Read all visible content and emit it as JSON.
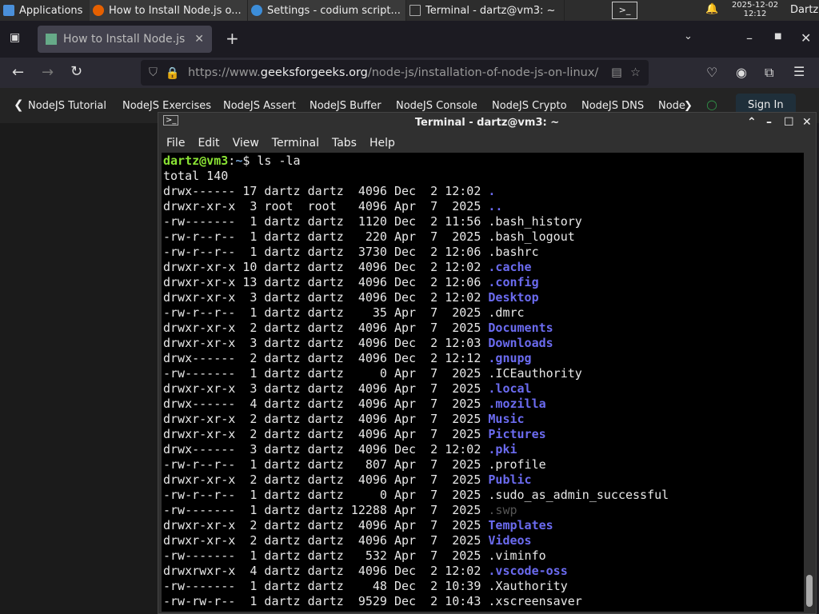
{
  "taskbar": {
    "applications": "Applications",
    "windows": [
      "How to Install Node.js o...",
      "Settings - codium script...",
      "Terminal - dartz@vm3: ~"
    ],
    "date": "2025-12-02",
    "time": "12:12",
    "user": "Dartz"
  },
  "browser": {
    "tab_title": "How to Install Node.js or",
    "url_prefix": "https://www.",
    "url_domain": "geeksforgeeks.org",
    "url_path": "/node-js/installation-of-node-js-on-linux/",
    "nav_items": [
      "NodeJS Tutorial",
      "NodeJS Exercises",
      "NodeJS Assert",
      "NodeJS Buffer",
      "NodeJS Console",
      "NodeJS Crypto",
      "NodeJS DNS",
      "Node"
    ],
    "sign_in": "Sign In"
  },
  "terminal": {
    "title": "Terminal - dartz@vm3: ~",
    "menu": [
      "File",
      "Edit",
      "View",
      "Terminal",
      "Tabs",
      "Help"
    ],
    "prompt_user": "dartz@vm3",
    "prompt_sep": ":",
    "prompt_path": "~",
    "prompt_end": "$ ",
    "command": "ls -la",
    "total": "total 140",
    "rows": [
      {
        "meta": "drwx------ 17 dartz dartz  4096 Dec  2 12:02 ",
        "name": ".",
        "kind": "dir"
      },
      {
        "meta": "drwxr-xr-x  3 root  root   4096 Apr  7  2025 ",
        "name": "..",
        "kind": "dir"
      },
      {
        "meta": "-rw-------  1 dartz dartz  1120 Dec  2 11:56 ",
        "name": ".bash_history",
        "kind": "file"
      },
      {
        "meta": "-rw-r--r--  1 dartz dartz   220 Apr  7  2025 ",
        "name": ".bash_logout",
        "kind": "file"
      },
      {
        "meta": "-rw-r--r--  1 dartz dartz  3730 Dec  2 12:06 ",
        "name": ".bashrc",
        "kind": "file"
      },
      {
        "meta": "drwxr-xr-x 10 dartz dartz  4096 Dec  2 12:02 ",
        "name": ".cache",
        "kind": "dir"
      },
      {
        "meta": "drwxr-xr-x 13 dartz dartz  4096 Dec  2 12:06 ",
        "name": ".config",
        "kind": "dir"
      },
      {
        "meta": "drwxr-xr-x  3 dartz dartz  4096 Dec  2 12:02 ",
        "name": "Desktop",
        "kind": "dir"
      },
      {
        "meta": "-rw-r--r--  1 dartz dartz    35 Apr  7  2025 ",
        "name": ".dmrc",
        "kind": "file"
      },
      {
        "meta": "drwxr-xr-x  2 dartz dartz  4096 Apr  7  2025 ",
        "name": "Documents",
        "kind": "dir"
      },
      {
        "meta": "drwxr-xr-x  3 dartz dartz  4096 Dec  2 12:03 ",
        "name": "Downloads",
        "kind": "dir"
      },
      {
        "meta": "drwx------  2 dartz dartz  4096 Dec  2 12:12 ",
        "name": ".gnupg",
        "kind": "dir"
      },
      {
        "meta": "-rw-------  1 dartz dartz     0 Apr  7  2025 ",
        "name": ".ICEauthority",
        "kind": "file"
      },
      {
        "meta": "drwxr-xr-x  3 dartz dartz  4096 Apr  7  2025 ",
        "name": ".local",
        "kind": "dir"
      },
      {
        "meta": "drwx------  4 dartz dartz  4096 Apr  7  2025 ",
        "name": ".mozilla",
        "kind": "dir"
      },
      {
        "meta": "drwxr-xr-x  2 dartz dartz  4096 Apr  7  2025 ",
        "name": "Music",
        "kind": "dir"
      },
      {
        "meta": "drwxr-xr-x  2 dartz dartz  4096 Apr  7  2025 ",
        "name": "Pictures",
        "kind": "dir"
      },
      {
        "meta": "drwx------  3 dartz dartz  4096 Dec  2 12:02 ",
        "name": ".pki",
        "kind": "dir"
      },
      {
        "meta": "-rw-r--r--  1 dartz dartz   807 Apr  7  2025 ",
        "name": ".profile",
        "kind": "file"
      },
      {
        "meta": "drwxr-xr-x  2 dartz dartz  4096 Apr  7  2025 ",
        "name": "Public",
        "kind": "dir"
      },
      {
        "meta": "-rw-r--r--  1 dartz dartz     0 Apr  7  2025 ",
        "name": ".sudo_as_admin_successful",
        "kind": "file"
      },
      {
        "meta": "-rw-------  1 dartz dartz 12288 Apr  7  2025 ",
        "name": ".swp",
        "kind": "dim"
      },
      {
        "meta": "drwxr-xr-x  2 dartz dartz  4096 Apr  7  2025 ",
        "name": "Templates",
        "kind": "dir"
      },
      {
        "meta": "drwxr-xr-x  2 dartz dartz  4096 Apr  7  2025 ",
        "name": "Videos",
        "kind": "dir"
      },
      {
        "meta": "-rw-------  1 dartz dartz   532 Apr  7  2025 ",
        "name": ".viminfo",
        "kind": "file"
      },
      {
        "meta": "drwxrwxr-x  4 dartz dartz  4096 Dec  2 12:02 ",
        "name": ".vscode-oss",
        "kind": "dir"
      },
      {
        "meta": "-rw-------  1 dartz dartz    48 Dec  2 10:39 ",
        "name": ".Xauthority",
        "kind": "file"
      },
      {
        "meta": "-rw-rw-r--  1 dartz dartz  9529 Dec  2 10:43 ",
        "name": ".xscreensaver",
        "kind": "file"
      }
    ]
  },
  "colors": {
    "dir": "#6b6bf0",
    "prompt_user": "#8ae234",
    "prompt_path": "#729fcf",
    "terminal_bg": "#000000"
  }
}
